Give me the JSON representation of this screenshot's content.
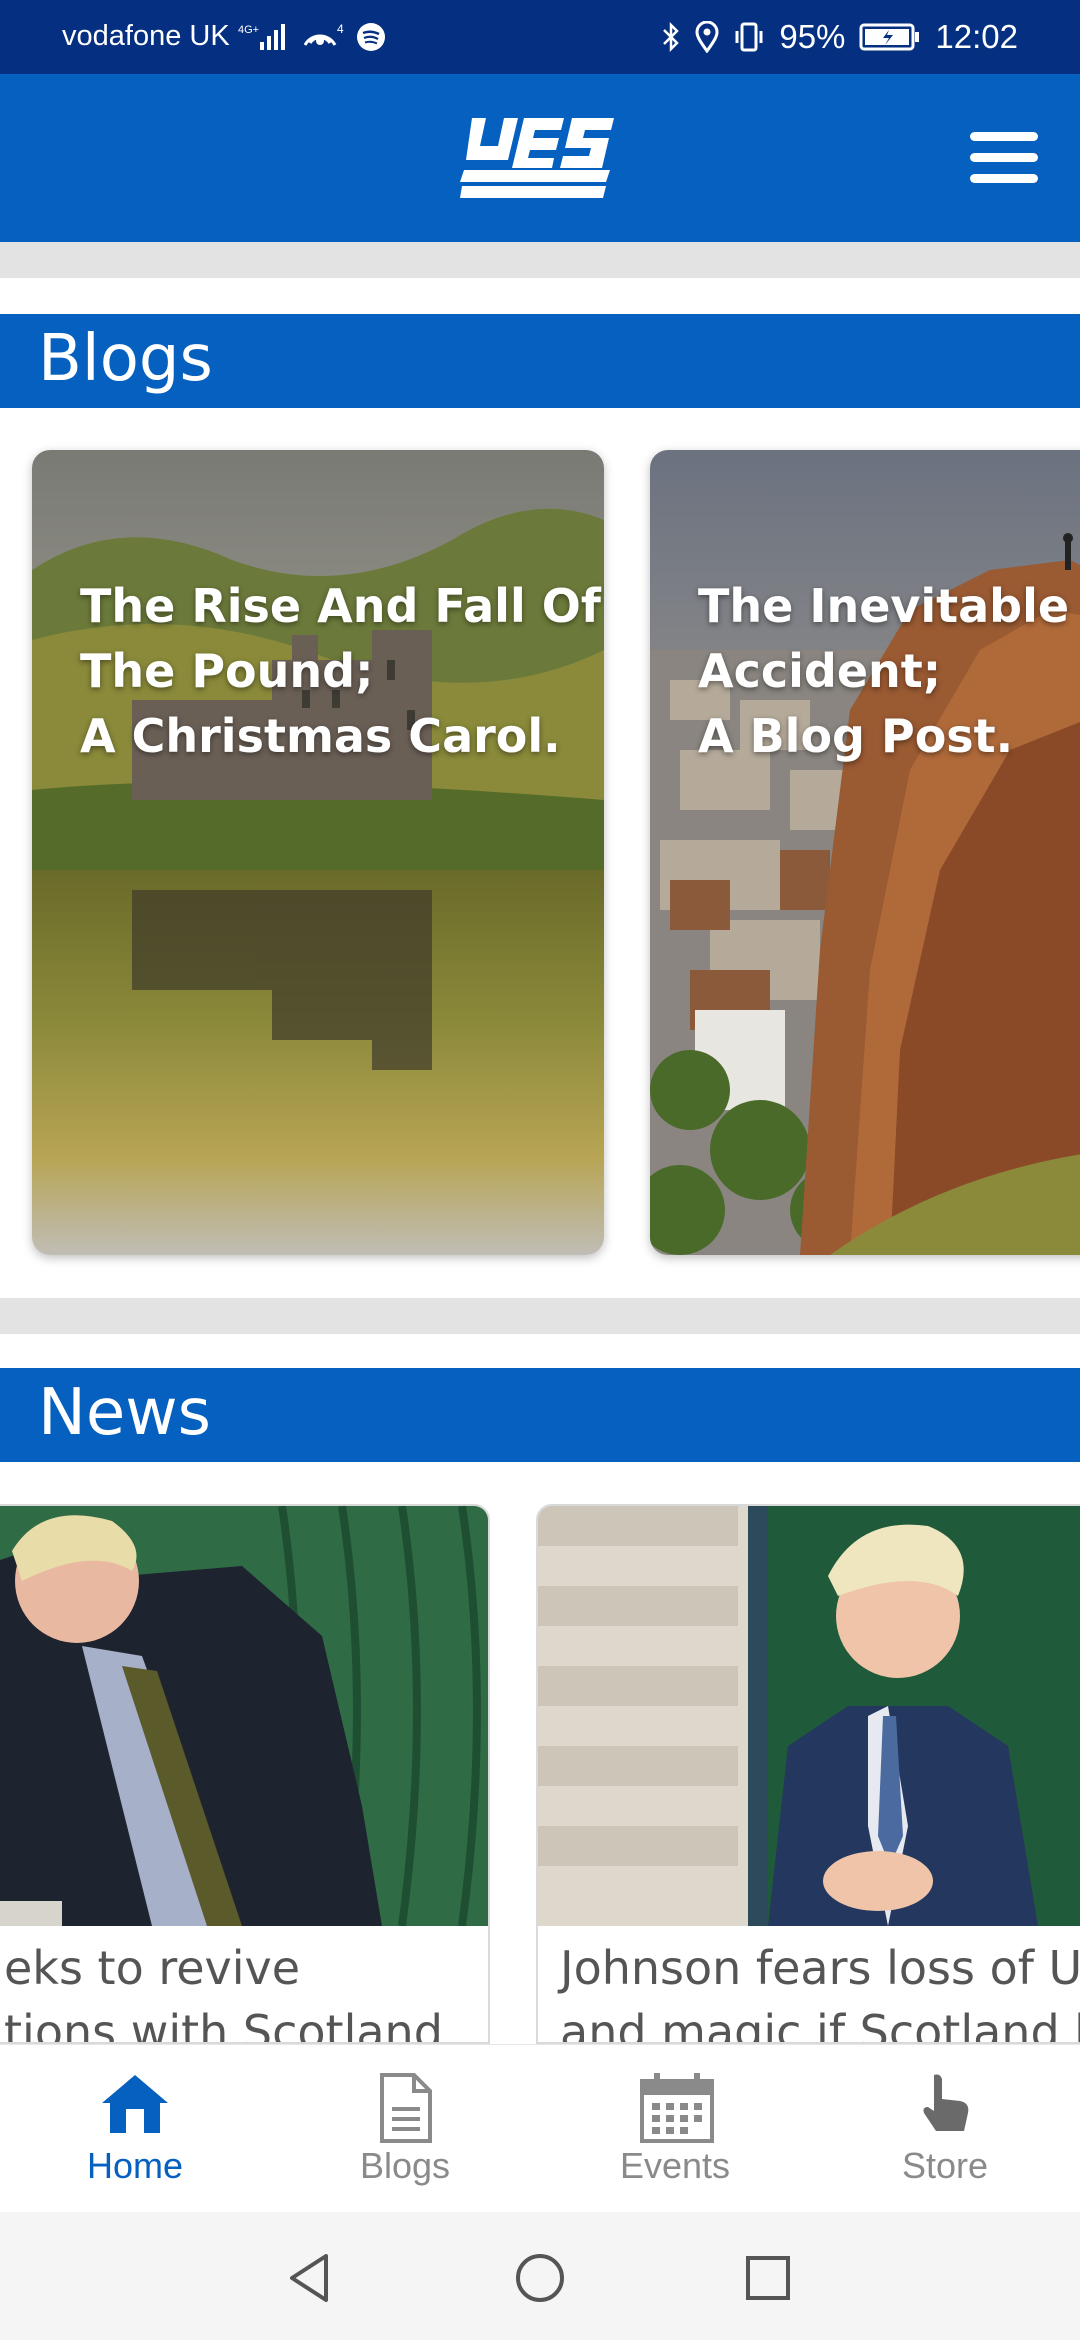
{
  "status_bar": {
    "carrier": "vodafone UK",
    "network": "4G+",
    "hotspot_count": "4",
    "battery": "95%",
    "time": "12:02"
  },
  "header": {
    "logo_text": "YES",
    "menu_icon": "hamburger-menu-icon"
  },
  "blogs": {
    "title": "Blogs",
    "cards": [
      {
        "lines": [
          "The Rise And Fall Of",
          "The Pound;",
          "A Christmas Carol."
        ]
      },
      {
        "lines": [
          "The Inevitable",
          "Accident;",
          "A Blog Post."
        ]
      }
    ]
  },
  "news": {
    "title": "News",
    "cards": [
      {
        "lines": [
          "eks to revive",
          "tions with Scotland"
        ]
      },
      {
        "lines": [
          "Johnson fears loss of U",
          "and magic if Scotland h"
        ]
      }
    ]
  },
  "bottom_nav": {
    "items": [
      {
        "label": "Home",
        "icon": "home-icon",
        "active": true
      },
      {
        "label": "Blogs",
        "icon": "document-icon",
        "active": false
      },
      {
        "label": "Events",
        "icon": "calendar-icon",
        "active": false
      },
      {
        "label": "Store",
        "icon": "hand-pointer-icon",
        "active": false
      }
    ]
  },
  "colors": {
    "status_bar": "#052f80",
    "brand_blue": "#0560bf",
    "divider_gray": "#e3e3e3",
    "inactive_nav": "#8a8a8a"
  }
}
